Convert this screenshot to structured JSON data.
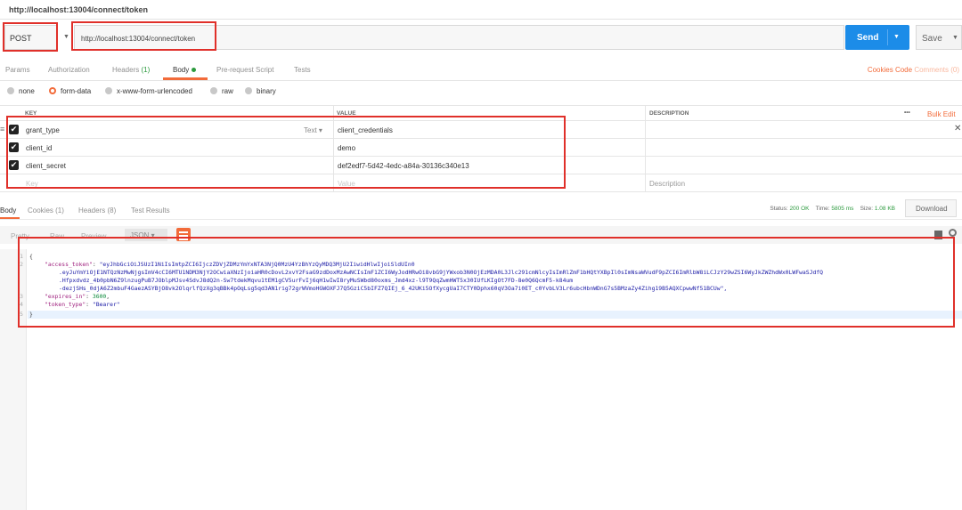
{
  "titlebar": {
    "title": "http://localhost:13004/connect/token"
  },
  "request": {
    "method": "POST",
    "url": "http://localhost:13004/connect/token",
    "send_label": "Send",
    "save_label": "Save"
  },
  "req_tabs": {
    "params": "Params",
    "authorization": "Authorization",
    "headers": "Headers",
    "headers_count": "(1)",
    "body": "Body",
    "pre_request": "Pre-request Script",
    "tests": "Tests",
    "cookies": "Cookies",
    "code": "Code",
    "comments": "Comments (0)"
  },
  "body_types": [
    "none",
    "form-data",
    "x-www-form-urlencoded",
    "raw",
    "binary"
  ],
  "kv": {
    "header_key": "KEY",
    "header_value": "VALUE",
    "header_description": "DESCRIPTION",
    "more": "•••",
    "bulk_edit": "Bulk Edit",
    "type_label": "Text",
    "rows": [
      {
        "key": "grant_type",
        "value": "client_credentials"
      },
      {
        "key": "client_id",
        "value": "demo"
      },
      {
        "key": "client_secret",
        "value": "def2edf7-5d42-4edc-a84a-30136c340e13"
      }
    ],
    "placeholder_key": "Key",
    "placeholder_value": "Value",
    "placeholder_description": "Description"
  },
  "response": {
    "tabs": {
      "body": "Body",
      "cookies": "Cookies (1)",
      "headers": "Headers (8)",
      "test_results": "Test Results"
    },
    "status_label": "Status:",
    "status_value": "200 OK",
    "time_label": "Time:",
    "time_value": "5805 ms",
    "size_label": "Size:",
    "size_value": "1.08 KB",
    "download_label": "Download",
    "view_tabs": {
      "pretty": "Pretty",
      "raw": "Raw",
      "preview": "Preview",
      "format": "JSON"
    },
    "lines": [
      {
        "n": "1",
        "text": "{"
      },
      {
        "n": "2",
        "key": "\"access_token\"",
        "value": "\"eyJhbGciOiJSUzI1NiIsImtpZCI6IjczZDVjZDMzYmYxNTA3NjQ0MzU4YzBhYzQyMDQ3MjU2IiwidHlwIjoiSldUIn0"
      },
      {
        "n": "",
        "cont": ".eyJuYmYiOjE1NTQzNzMwNjgsImV4cCI6MTU1NDM3NjY2OCwiaXNzIjoiaHR0cDovL2xvY2FsaG9zdDoxMzAwNCIsImF1ZCI6WyJodHRwOi8vbG9jYWxob3N0OjEzMDA0L3Jlc291cmNlcyIsImRlZmF1bHQtYXBpIl0sImNsaWVudF9pZCI6ImRlbW8iLCJzY29wZSI6WyJkZWZhdWx0LWFwaSJdfQ"
      },
      {
        "n": "",
        "cont": ".Hfpxdvdz_4b0pbN6Z9lnzugPuB7JOblpMJsv4SdvJ8dQ2n-Sw7tdekMqvu1tEM1gCV5urFvIj6qH1wIwI8ryMuSWbd80oxms_Jmd4xz-l9T9QqZwmHWT5x30IUfLKIgOt7FD-8e0Q6QcmF5-k84um"
      },
      {
        "n": "",
        "cont": "-dezjSHs_0djA6Z2mbuF4GaezASYBjO8vk2OlqrlfQzXg3qBBk4pOqLsg5qd3AN1rig72grWVmoHGWOXFJ7Q5GziC5bIFZ7QIEj_6_42UKi5OfXycgUaI7CTY0Dphx60qV3Oa7i0ET_c0YvbLV3Lr6ubcHbnWDnG7s5BMzaZy4Zihg19B5AQXCpwwNf51BCUw\","
      },
      {
        "n": "3",
        "key": "\"expires_in\"",
        "num": "3600"
      },
      {
        "n": "4",
        "key": "\"token_type\"",
        "value": "\"Bearer\""
      },
      {
        "n": "5",
        "text": "}"
      }
    ]
  },
  "colors": {
    "accent": "#f26b3a",
    "send": "#1c8ce8",
    "annotation": "#e0302a",
    "status_ok": "#2c9a3e"
  }
}
